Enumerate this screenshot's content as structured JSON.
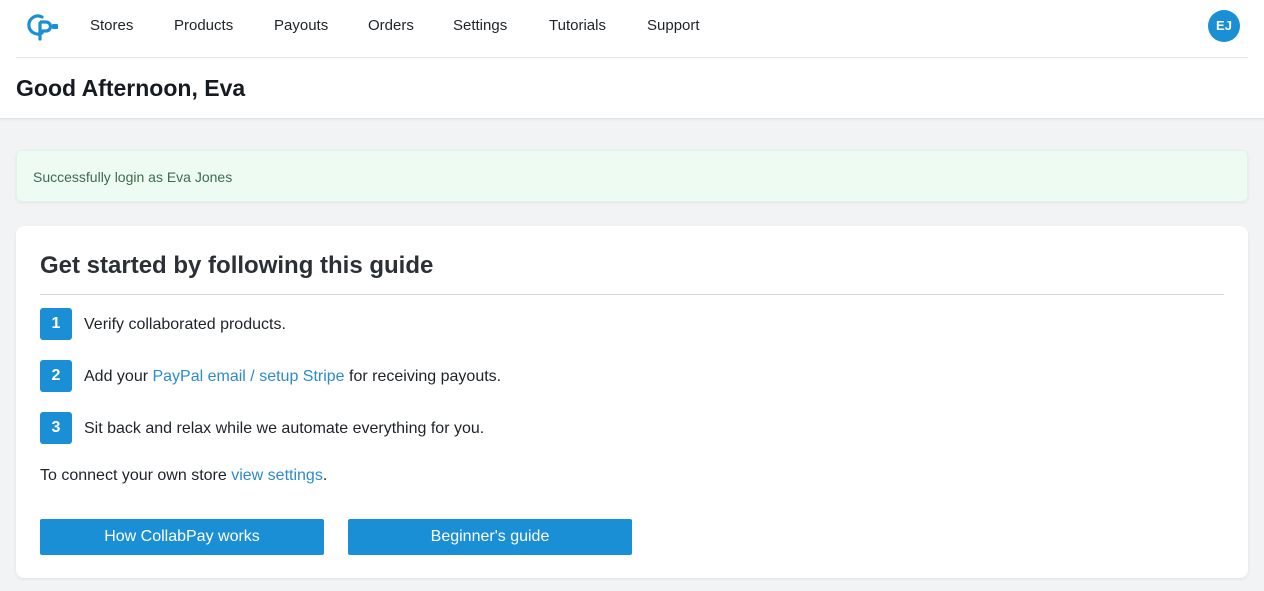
{
  "nav": {
    "logo_icon": "collabpay-logo-icon",
    "items": [
      {
        "label": "Stores"
      },
      {
        "label": "Products"
      },
      {
        "label": "Payouts"
      },
      {
        "label": "Orders"
      },
      {
        "label": "Settings"
      },
      {
        "label": "Tutorials"
      },
      {
        "label": "Support"
      }
    ],
    "avatar_initials": "EJ"
  },
  "header": {
    "greeting": "Good Afternoon, Eva"
  },
  "alert": {
    "message": "Successfully login as Eva Jones"
  },
  "guide": {
    "title": "Get started by following this guide",
    "steps": [
      {
        "number": "1",
        "text": "Verify collaborated products."
      },
      {
        "number": "2",
        "prefix": "Add your ",
        "link": "PayPal email / setup Stripe",
        "suffix": " for receiving payouts."
      },
      {
        "number": "3",
        "text": "Sit back and relax while we automate everything for you."
      }
    ],
    "connect": {
      "prefix": "To connect your own store ",
      "link": "view settings",
      "suffix": "."
    },
    "buttons": {
      "how_it_works": "How CollabPay works",
      "beginners_guide": "Beginner's guide"
    }
  },
  "colors": {
    "accent": "#1b8fd6",
    "link": "#2b8ad0",
    "alert_bg": "#eefbf3",
    "alert_text": "#3d6b4f",
    "page_bg": "#f2f3f5"
  }
}
